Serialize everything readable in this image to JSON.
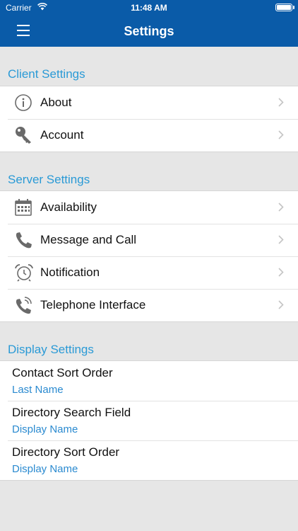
{
  "status": {
    "carrier": "Carrier",
    "time": "11:48 AM"
  },
  "nav": {
    "title": "Settings"
  },
  "client": {
    "header": "Client Settings",
    "items": [
      {
        "label": "About",
        "icon": "info-icon"
      },
      {
        "label": "Account",
        "icon": "key-icon"
      }
    ]
  },
  "server": {
    "header": "Server Settings",
    "items": [
      {
        "label": "Availability",
        "icon": "calendar-icon"
      },
      {
        "label": "Message and Call",
        "icon": "phone-icon"
      },
      {
        "label": "Notification",
        "icon": "alarm-clock-icon"
      },
      {
        "label": "Telephone Interface",
        "icon": "phone-ringing-icon"
      }
    ]
  },
  "display": {
    "header": "Display Settings",
    "items": [
      {
        "label": "Contact Sort Order",
        "value": "Last Name"
      },
      {
        "label": "Directory Search Field",
        "value": "Display Name"
      },
      {
        "label": "Directory Sort Order",
        "value": "Display Name"
      }
    ]
  }
}
